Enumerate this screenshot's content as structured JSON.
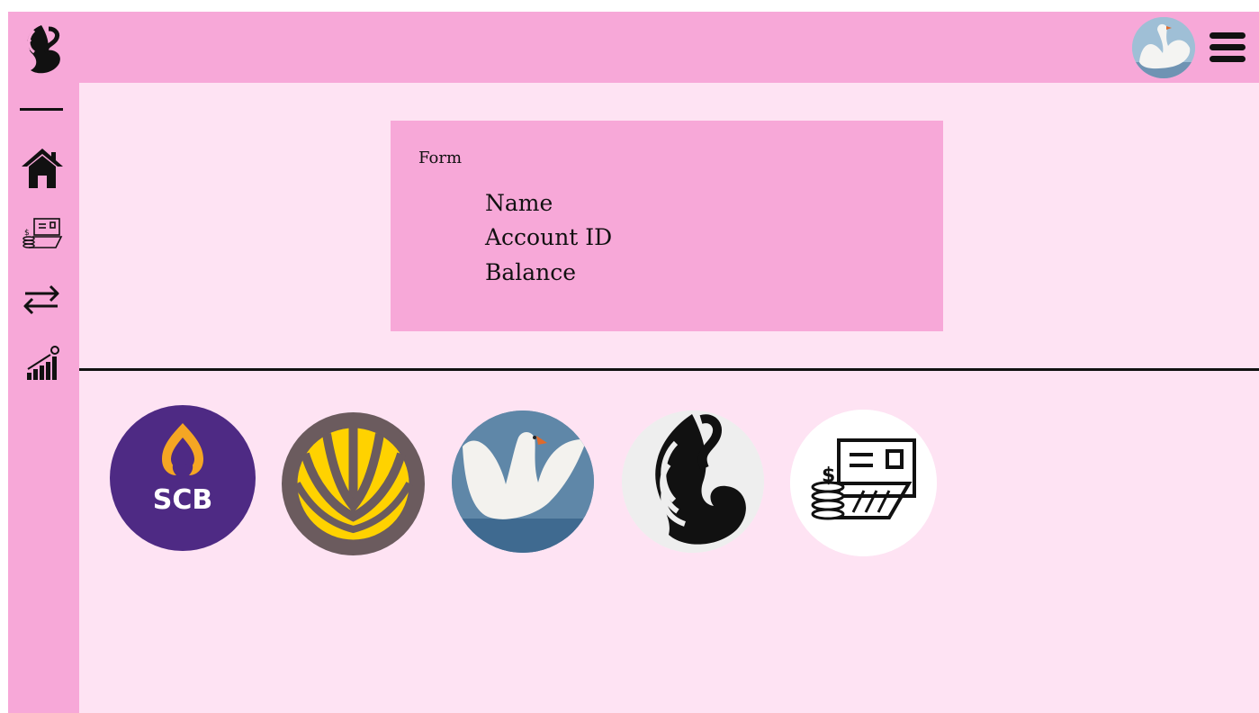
{
  "form": {
    "title": "Form",
    "fields": [
      {
        "label": "Name"
      },
      {
        "label": "Account ID"
      },
      {
        "label": "Balance"
      }
    ]
  },
  "bank_logos": [
    {
      "name": "scb",
      "text": "SCB"
    },
    {
      "name": "krungsri"
    },
    {
      "name": "swan-photo"
    },
    {
      "name": "swan-logo"
    },
    {
      "name": "payment-app"
    }
  ],
  "icons": {
    "brand": "swan-logo-icon",
    "nav": [
      "home-icon",
      "payment-icon",
      "transfer-icon",
      "stats-icon"
    ],
    "menu": "hamburger-menu-icon"
  },
  "colors": {
    "bar": "#f7a8d8",
    "content": "#fee3f3",
    "scb": "#4e2a84",
    "krungsri": "#6b5b5e",
    "krungsri_yellow": "#ffd200",
    "scb_gold": "#f5a623"
  }
}
